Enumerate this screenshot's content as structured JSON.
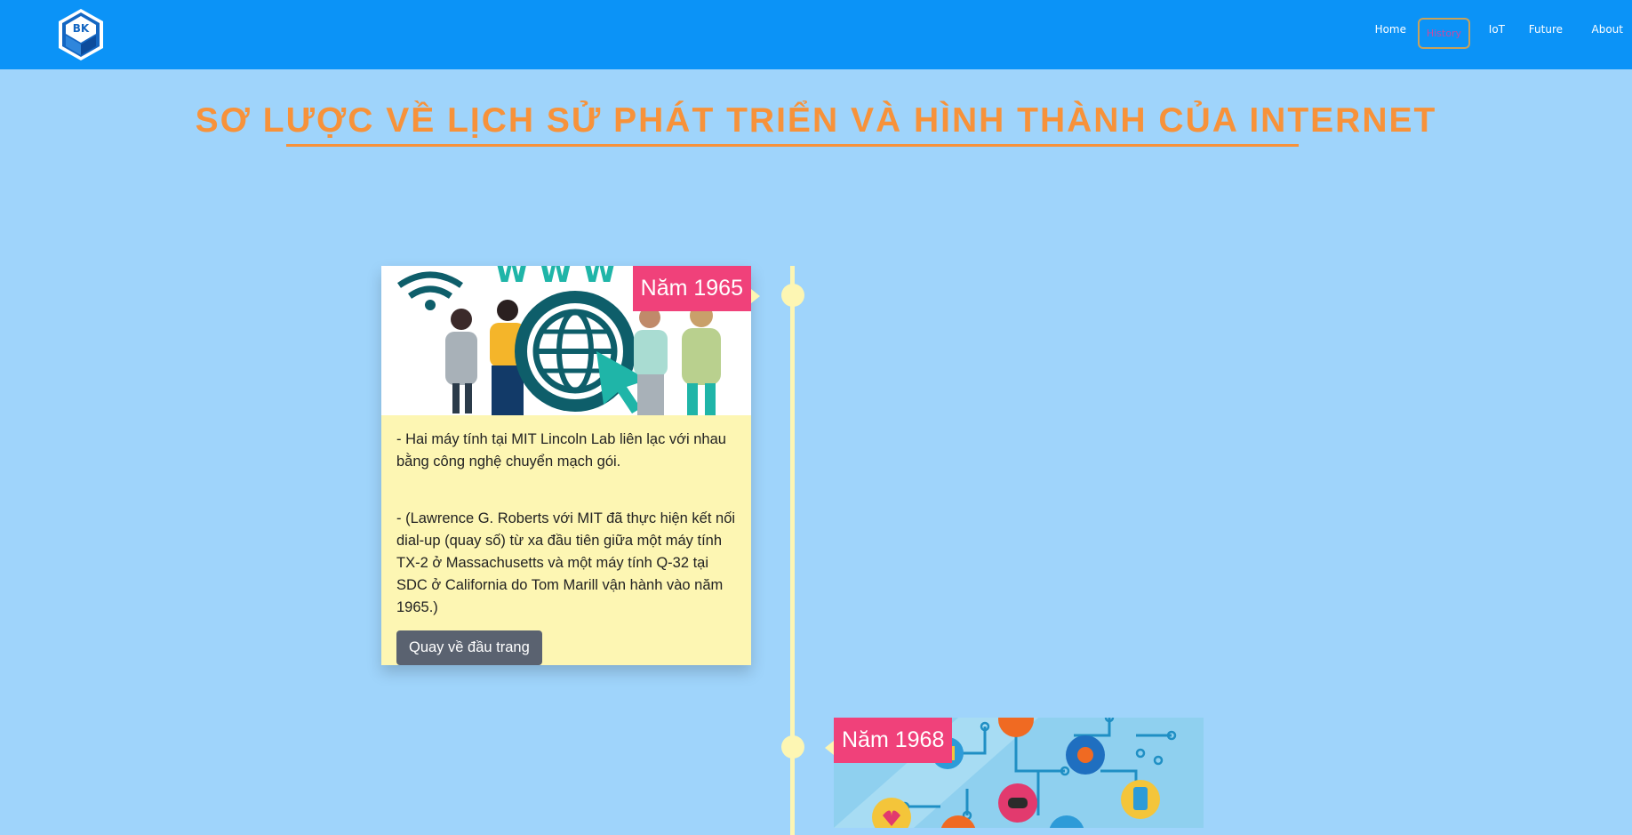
{
  "navbar": {
    "logo_text": "BK",
    "items": [
      {
        "label": "Home"
      },
      {
        "label": "History"
      },
      {
        "label": "IoT"
      },
      {
        "label": "Future"
      },
      {
        "label": "About"
      }
    ],
    "active_item": "History",
    "colors": {
      "background": "#0b93f7",
      "active_text": "#c84aa0",
      "active_border": "#c9a25a"
    }
  },
  "page": {
    "title": "SƠ LƯỢC VỀ LỊCH SỬ PHÁT TRIỂN VÀ HÌNH THÀNH CỦA INTERNET",
    "colors": {
      "background": "#9fd4fb",
      "title": "#f7923a",
      "timeline": "#fdf6b3",
      "badge": "#f0417a"
    }
  },
  "timeline": [
    {
      "year": "Năm 1965",
      "image_icon": "people-globe-www-illustration",
      "paragraphs": [
        "- Hai máy tính tại MIT Lincoln Lab liên lạc với nhau bằng công nghệ chuyển mạch gói.",
        "- (Lawrence G. Roberts với MIT đã thực hiện kết nối dial-up (quay số) từ xa đầu tiên giữa một máy tính TX-2 ở Massachusetts và một máy tính Q-32 tại SDC ở California do Tom Marill vận hành vào năm 1965.)"
      ],
      "button_label": "Quay về đầu trang"
    },
    {
      "year": "Năm 1968",
      "image_icon": "iot-circuit-illustration"
    }
  ]
}
